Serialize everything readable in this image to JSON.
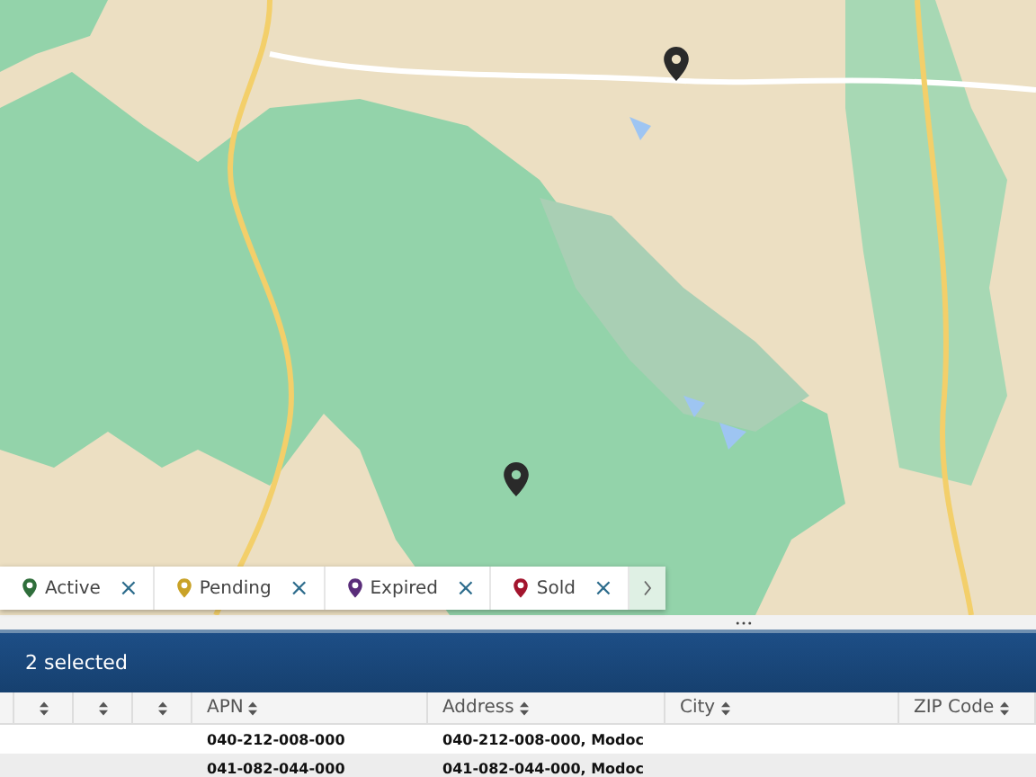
{
  "legend": [
    {
      "label": "Active",
      "color": "#2f6e3b",
      "remove": "×"
    },
    {
      "label": "Pending",
      "color": "#c9a227",
      "remove": "×"
    },
    {
      "label": "Expired",
      "color": "#5a2d7a",
      "remove": "×"
    },
    {
      "label": "Sold",
      "color": "#a3152e",
      "remove": "×"
    }
  ],
  "selection_bar": {
    "text": "2 selected"
  },
  "table": {
    "columns": [
      "APN",
      "Address",
      "City",
      "ZIP Code"
    ],
    "rows": [
      {
        "apn": "040-212-008-000",
        "address": "040-212-008-000, Modoc"
      },
      {
        "apn": "041-082-044-000",
        "address": "041-082-044-000, Modoc"
      }
    ]
  }
}
